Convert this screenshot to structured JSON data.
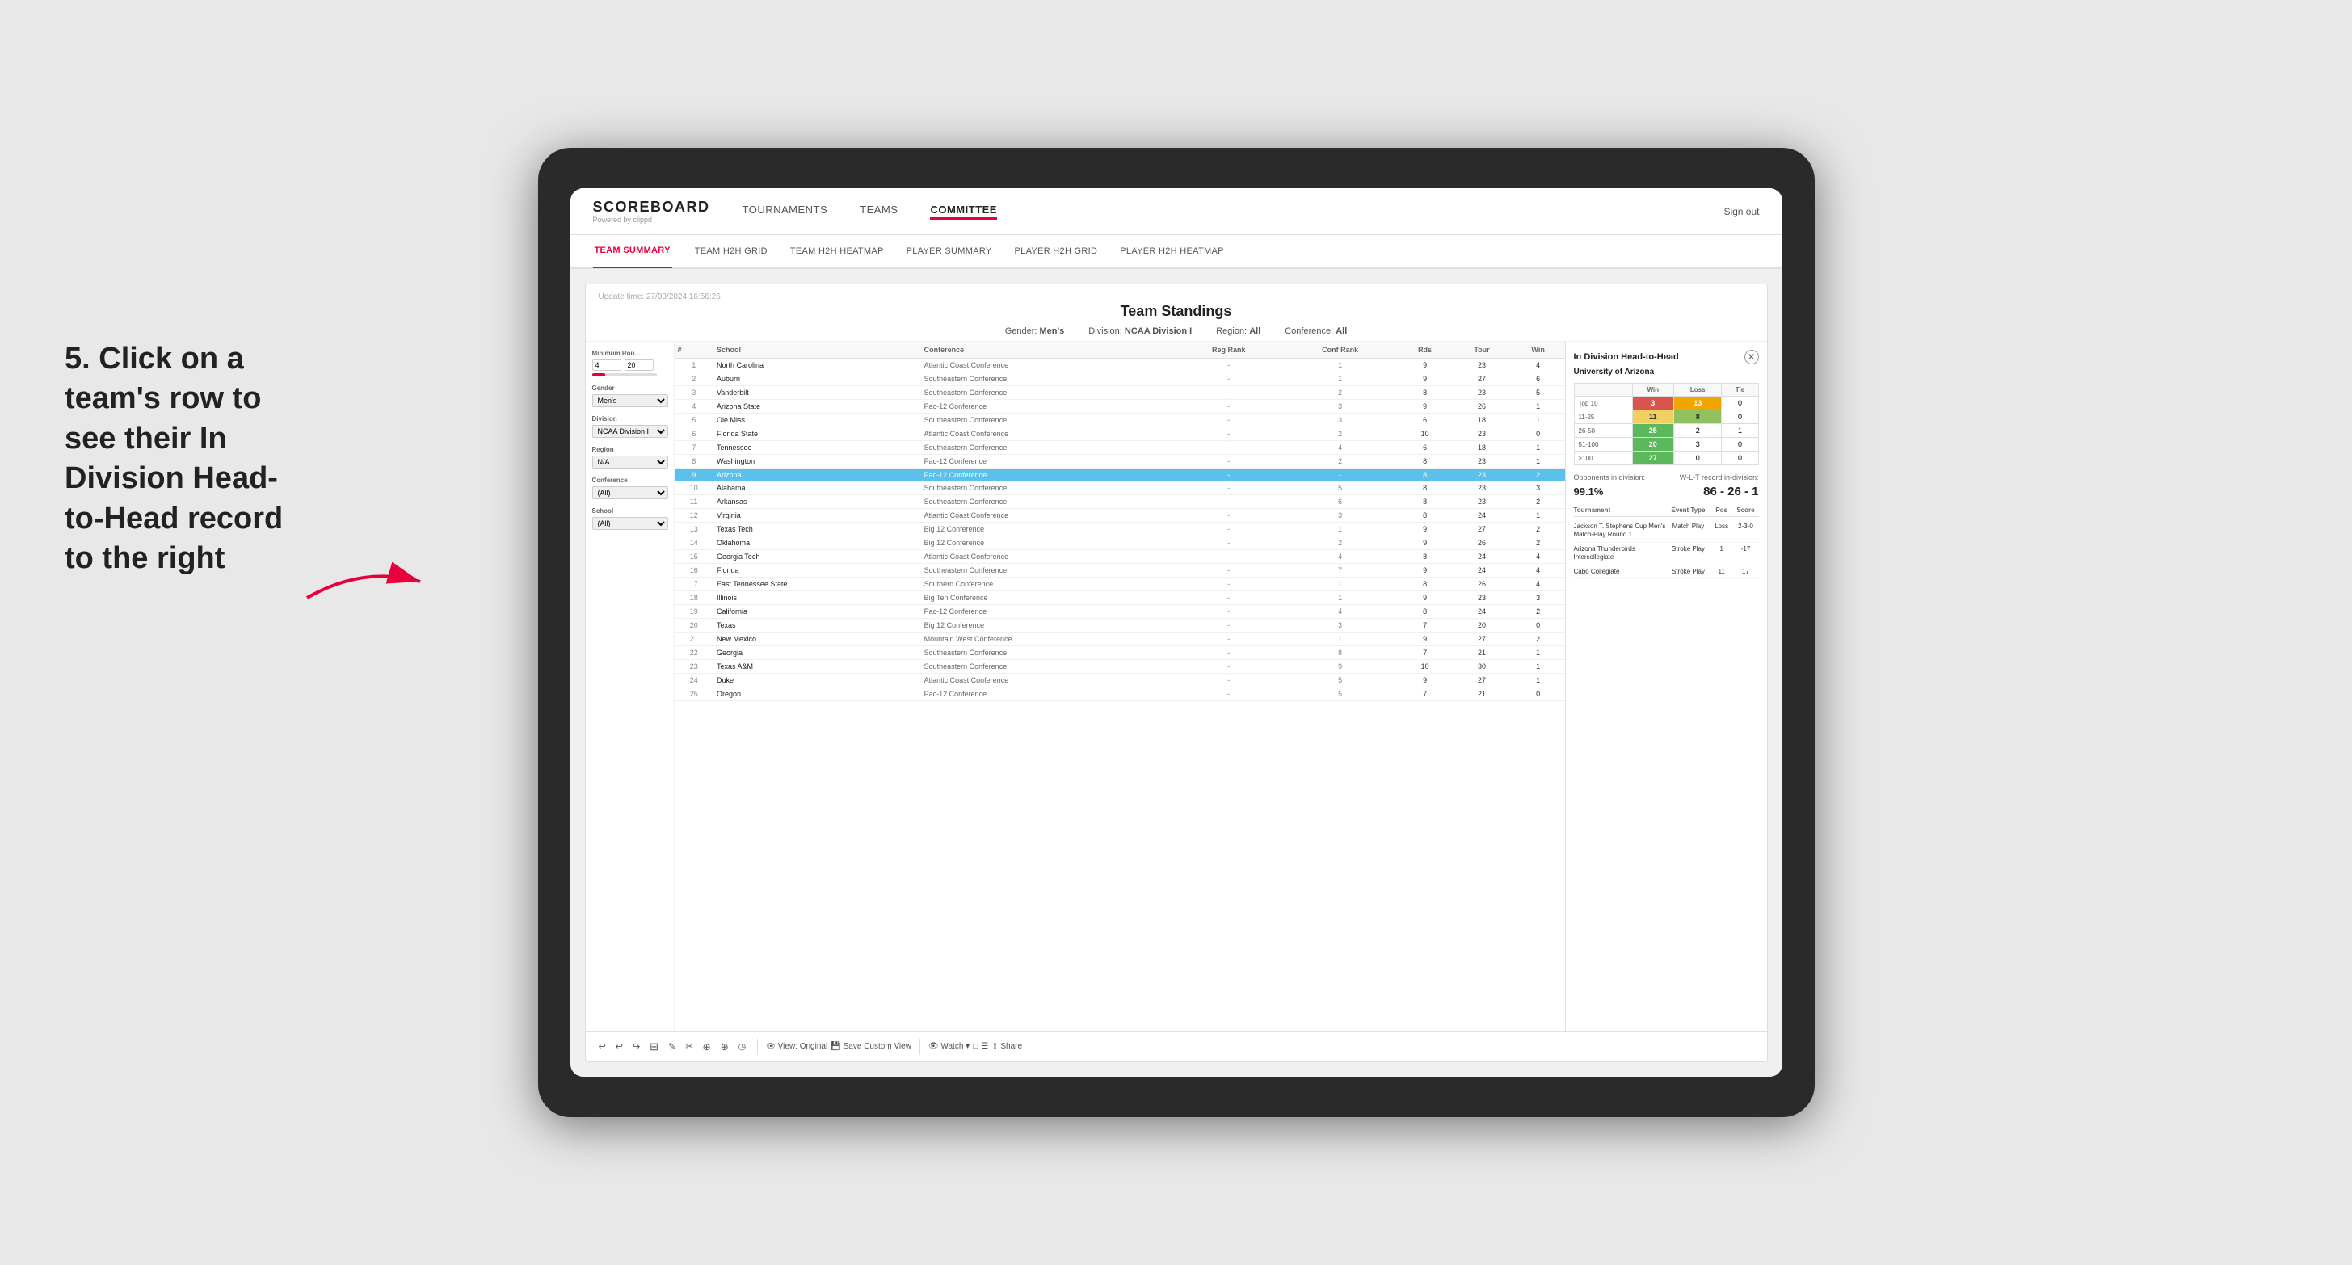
{
  "instruction": {
    "text": "5. Click on a team's row to see their In Division Head-to-Head record to the right"
  },
  "nav": {
    "logo": "SCOREBOARD",
    "logo_sub": "Powered by clippd",
    "items": [
      "TOURNAMENTS",
      "TEAMS",
      "COMMITTEE"
    ],
    "active_item": "COMMITTEE",
    "sign_out": "Sign out"
  },
  "sub_nav": {
    "items": [
      "TEAM SUMMARY",
      "TEAM H2H GRID",
      "TEAM H2H HEATMAP",
      "PLAYER SUMMARY",
      "PLAYER H2H GRID",
      "PLAYER H2H HEATMAP"
    ],
    "active_item": "PLAYER SUMMARY"
  },
  "card": {
    "title": "Team Standings",
    "update_time": "Update time: 27/03/2024 16:56:26",
    "filters": {
      "gender": "Men's",
      "division": "NCAA Division I",
      "region": "All",
      "conference": "All"
    }
  },
  "sidebar": {
    "min_rounds_label": "Minimum Rou...",
    "min_rounds_value": "4",
    "min_rounds_max": "20",
    "gender_label": "Gender",
    "gender_value": "Men's",
    "division_label": "Division",
    "division_value": "NCAA Division I",
    "region_label": "Region",
    "region_value": "N/A",
    "conference_label": "Conference",
    "conference_value": "(All)",
    "school_label": "School",
    "school_value": "(All)"
  },
  "table": {
    "headers": [
      "#",
      "School",
      "Conference",
      "Reg Rank",
      "Conf Rank",
      "Rds",
      "Tour",
      "Win"
    ],
    "rows": [
      {
        "num": 1,
        "school": "North Carolina",
        "conference": "Atlantic Coast Conference",
        "reg_rank": "-",
        "conf_rank": "1",
        "rds": "9",
        "tour": "23",
        "win": "4"
      },
      {
        "num": 2,
        "school": "Auburn",
        "conference": "Southeastern Conference",
        "reg_rank": "-",
        "conf_rank": "1",
        "rds": "9",
        "tour": "27",
        "win": "6"
      },
      {
        "num": 3,
        "school": "Vanderbilt",
        "conference": "Southeastern Conference",
        "reg_rank": "-",
        "conf_rank": "2",
        "rds": "8",
        "tour": "23",
        "win": "5"
      },
      {
        "num": 4,
        "school": "Arizona State",
        "conference": "Pac-12 Conference",
        "reg_rank": "-",
        "conf_rank": "3",
        "rds": "9",
        "tour": "26",
        "win": "1"
      },
      {
        "num": 5,
        "school": "Ole Miss",
        "conference": "Southeastern Conference",
        "reg_rank": "-",
        "conf_rank": "3",
        "rds": "6",
        "tour": "18",
        "win": "1"
      },
      {
        "num": 6,
        "school": "Florida State",
        "conference": "Atlantic Coast Conference",
        "reg_rank": "-",
        "conf_rank": "2",
        "rds": "10",
        "tour": "23",
        "win": "0"
      },
      {
        "num": 7,
        "school": "Tennessee",
        "conference": "Southeastern Conference",
        "reg_rank": "-",
        "conf_rank": "4",
        "rds": "6",
        "tour": "18",
        "win": "1"
      },
      {
        "num": 8,
        "school": "Washington",
        "conference": "Pac-12 Conference",
        "reg_rank": "-",
        "conf_rank": "2",
        "rds": "8",
        "tour": "23",
        "win": "1"
      },
      {
        "num": 9,
        "school": "Arizona",
        "conference": "Pac-12 Conference",
        "reg_rank": "-",
        "conf_rank": "-",
        "rds": "8",
        "tour": "23",
        "win": "2",
        "highlighted": true
      },
      {
        "num": 10,
        "school": "Alabama",
        "conference": "Southeastern Conference",
        "reg_rank": "-",
        "conf_rank": "5",
        "rds": "8",
        "tour": "23",
        "win": "3"
      },
      {
        "num": 11,
        "school": "Arkansas",
        "conference": "Southeastern Conference",
        "reg_rank": "-",
        "conf_rank": "6",
        "rds": "8",
        "tour": "23",
        "win": "2"
      },
      {
        "num": 12,
        "school": "Virginia",
        "conference": "Atlantic Coast Conference",
        "reg_rank": "-",
        "conf_rank": "3",
        "rds": "8",
        "tour": "24",
        "win": "1"
      },
      {
        "num": 13,
        "school": "Texas Tech",
        "conference": "Big 12 Conference",
        "reg_rank": "-",
        "conf_rank": "1",
        "rds": "9",
        "tour": "27",
        "win": "2"
      },
      {
        "num": 14,
        "school": "Oklahoma",
        "conference": "Big 12 Conference",
        "reg_rank": "-",
        "conf_rank": "2",
        "rds": "9",
        "tour": "26",
        "win": "2"
      },
      {
        "num": 15,
        "school": "Georgia Tech",
        "conference": "Atlantic Coast Conference",
        "reg_rank": "-",
        "conf_rank": "4",
        "rds": "8",
        "tour": "24",
        "win": "4"
      },
      {
        "num": 16,
        "school": "Florida",
        "conference": "Southeastern Conference",
        "reg_rank": "-",
        "conf_rank": "7",
        "rds": "9",
        "tour": "24",
        "win": "4"
      },
      {
        "num": 17,
        "school": "East Tennessee State",
        "conference": "Southern Conference",
        "reg_rank": "-",
        "conf_rank": "1",
        "rds": "8",
        "tour": "26",
        "win": "4"
      },
      {
        "num": 18,
        "school": "Illinois",
        "conference": "Big Ten Conference",
        "reg_rank": "-",
        "conf_rank": "1",
        "rds": "9",
        "tour": "23",
        "win": "3"
      },
      {
        "num": 19,
        "school": "California",
        "conference": "Pac-12 Conference",
        "reg_rank": "-",
        "conf_rank": "4",
        "rds": "8",
        "tour": "24",
        "win": "2"
      },
      {
        "num": 20,
        "school": "Texas",
        "conference": "Big 12 Conference",
        "reg_rank": "-",
        "conf_rank": "3",
        "rds": "7",
        "tour": "20",
        "win": "0"
      },
      {
        "num": 21,
        "school": "New Mexico",
        "conference": "Mountain West Conference",
        "reg_rank": "-",
        "conf_rank": "1",
        "rds": "9",
        "tour": "27",
        "win": "2"
      },
      {
        "num": 22,
        "school": "Georgia",
        "conference": "Southeastern Conference",
        "reg_rank": "-",
        "conf_rank": "8",
        "rds": "7",
        "tour": "21",
        "win": "1"
      },
      {
        "num": 23,
        "school": "Texas A&M",
        "conference": "Southeastern Conference",
        "reg_rank": "-",
        "conf_rank": "9",
        "rds": "10",
        "tour": "30",
        "win": "1"
      },
      {
        "num": 24,
        "school": "Duke",
        "conference": "Atlantic Coast Conference",
        "reg_rank": "-",
        "conf_rank": "5",
        "rds": "9",
        "tour": "27",
        "win": "1"
      },
      {
        "num": 25,
        "school": "Oregon",
        "conference": "Pac-12 Conference",
        "reg_rank": "-",
        "conf_rank": "5",
        "rds": "7",
        "tour": "21",
        "win": "0"
      }
    ]
  },
  "right_panel": {
    "title": "In Division Head-to-Head",
    "team_name": "University of Arizona",
    "h2h_table": {
      "headers": [
        "",
        "Win",
        "Loss",
        "Tie"
      ],
      "rows": [
        {
          "label": "Top 10",
          "win": "3",
          "loss": "13",
          "tie": "0",
          "win_class": "cell-red",
          "loss_class": "cell-orange"
        },
        {
          "label": "11-25",
          "win": "11",
          "loss": "8",
          "tie": "0",
          "win_class": "cell-yellow",
          "loss_class": "cell-lightgreen"
        },
        {
          "label": "26-50",
          "win": "25",
          "loss": "2",
          "tie": "1",
          "win_class": "cell-green"
        },
        {
          "label": "51-100",
          "win": "20",
          "loss": "3",
          "tie": "0",
          "win_class": "cell-green"
        },
        {
          "label": ">100",
          "win": "27",
          "loss": "0",
          "tie": "0",
          "win_class": "cell-green"
        }
      ]
    },
    "opponents_pct": "99.1%",
    "opponents_label": "Opponents in division:",
    "wl_label": "W-L-T record in-division:",
    "wl_record": "86 - 26 - 1",
    "tournaments": {
      "headers": [
        "Tournament",
        "Event Type",
        "Pos",
        "Score"
      ],
      "rows": [
        {
          "name": "Jackson T. Stephens Cup Men's Match-Play Round",
          "type": "Match Play",
          "pos": "Loss",
          "score": "2-3-0",
          "extra": "1"
        },
        {
          "name": "Arizona Thunderbirds Intercollegiate",
          "type": "Stroke Play",
          "pos": "1",
          "score": "-17"
        },
        {
          "name": "Cabo Collegiate",
          "type": "Stroke Play",
          "pos": "11",
          "score": "17"
        }
      ]
    }
  },
  "toolbar": {
    "buttons": [
      "↩",
      "↩",
      "↪",
      "⊞",
      "✎",
      "✂",
      "⊕",
      "⊕",
      "◷"
    ],
    "view_original": "View: Original",
    "save_custom": "Save Custom View",
    "watch": "Watch",
    "icons_right": [
      "□",
      "☰",
      "⇪ Share"
    ]
  }
}
